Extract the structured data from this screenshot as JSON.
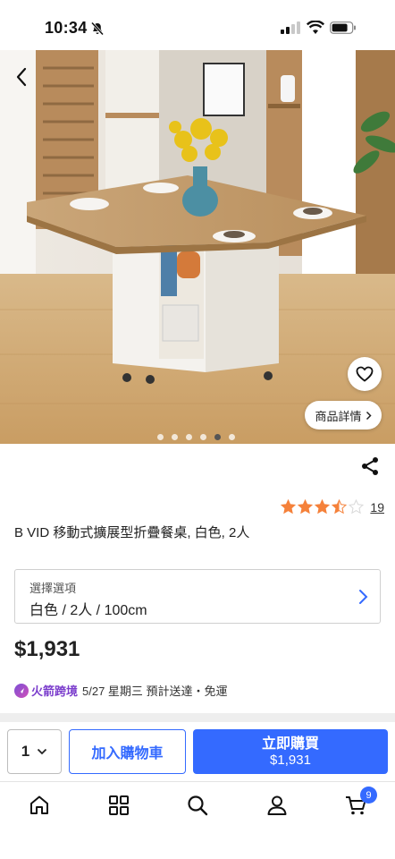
{
  "status_bar": {
    "time": "10:34"
  },
  "product": {
    "title": "B VID 移動式擴展型折疊餐桌, 白色, 2人",
    "rating_stars": 3.5,
    "rating_count": "19",
    "price": "$1,931",
    "details_label": "商品詳情",
    "image_count": 6,
    "active_image_index": 4
  },
  "option": {
    "label": "選擇選項",
    "value": "白色 / 2人 / 100cm"
  },
  "delivery": {
    "brand": "火箭跨境",
    "text": "5/27 星期三 預計送達・免運"
  },
  "actions": {
    "quantity": "1",
    "add_to_cart": "加入購物車",
    "buy_now": "立即購買",
    "buy_now_price": "$1,931"
  },
  "tabbar": {
    "items": [
      "home-icon",
      "categories-icon",
      "search-icon",
      "account-icon",
      "cart-icon"
    ],
    "cart_count": "9"
  },
  "colors": {
    "accent": "#346aff",
    "star": "#f5813a",
    "rocket": "#7a3ccc"
  }
}
